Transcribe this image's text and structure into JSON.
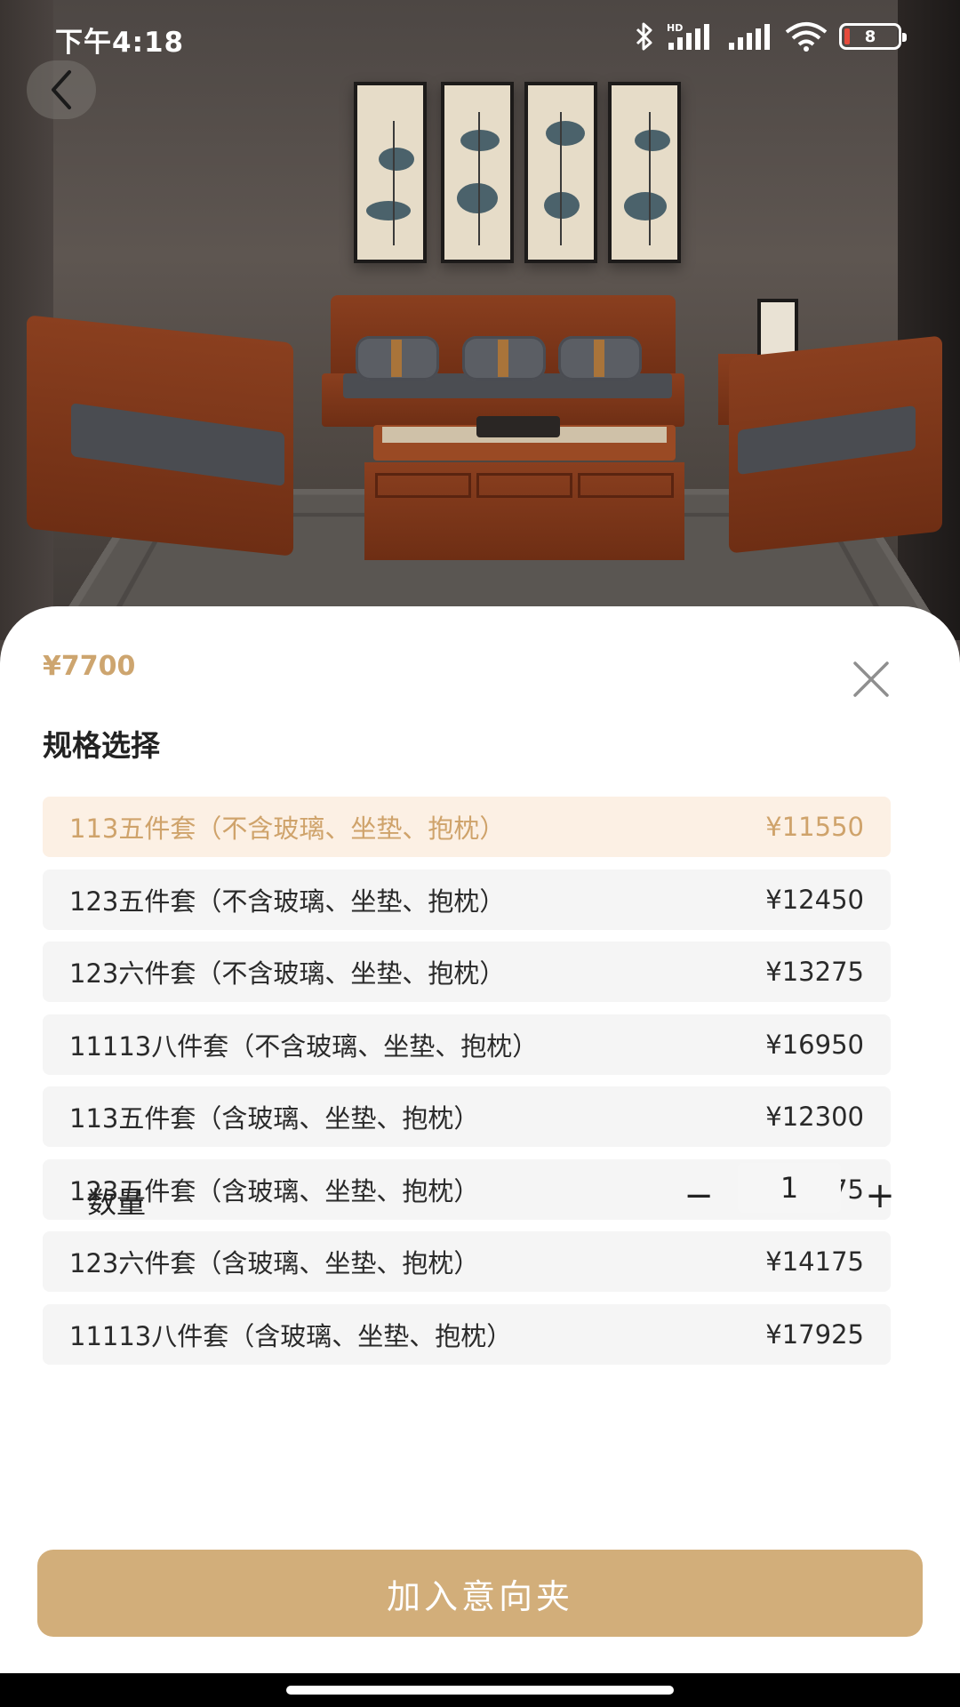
{
  "status_bar": {
    "time": "下午4:18",
    "network_label": "HD",
    "battery_level": "8",
    "battery_color": "#e64a3b"
  },
  "header": {
    "back_icon": "chevron-left-icon"
  },
  "sheet": {
    "price": "¥7700",
    "close_icon": "close-icon",
    "section_title": "规格选择",
    "accent_color": "#cda56f",
    "specs": [
      {
        "name": "113五件套（不含玻璃、坐垫、抱枕）",
        "price": "¥11550",
        "selected": true
      },
      {
        "name": "123五件套（不含玻璃、坐垫、抱枕）",
        "price": "¥12450",
        "selected": false
      },
      {
        "name": "123六件套（不含玻璃、坐垫、抱枕）",
        "price": "¥13275",
        "selected": false
      },
      {
        "name": "11113八件套（不含玻璃、坐垫、抱枕）",
        "price": "¥16950",
        "selected": false
      },
      {
        "name": "113五件套（含玻璃、坐垫、抱枕）",
        "price": "¥12300",
        "selected": false
      },
      {
        "name": "123五件套（含玻璃、坐垫、抱枕）",
        "price": "¥13275",
        "selected": false
      },
      {
        "name": "123六件套（含玻璃、坐垫、抱枕）",
        "price": "¥14175",
        "selected": false
      },
      {
        "name": "11113八件套（含玻璃、坐垫、抱枕）",
        "price": "¥17925",
        "selected": false
      }
    ],
    "quantity": {
      "label": "数量",
      "minus": "−",
      "value": "1",
      "plus": "+"
    },
    "add_button": "加入意向夹",
    "button_color": "#d2ae7a"
  }
}
